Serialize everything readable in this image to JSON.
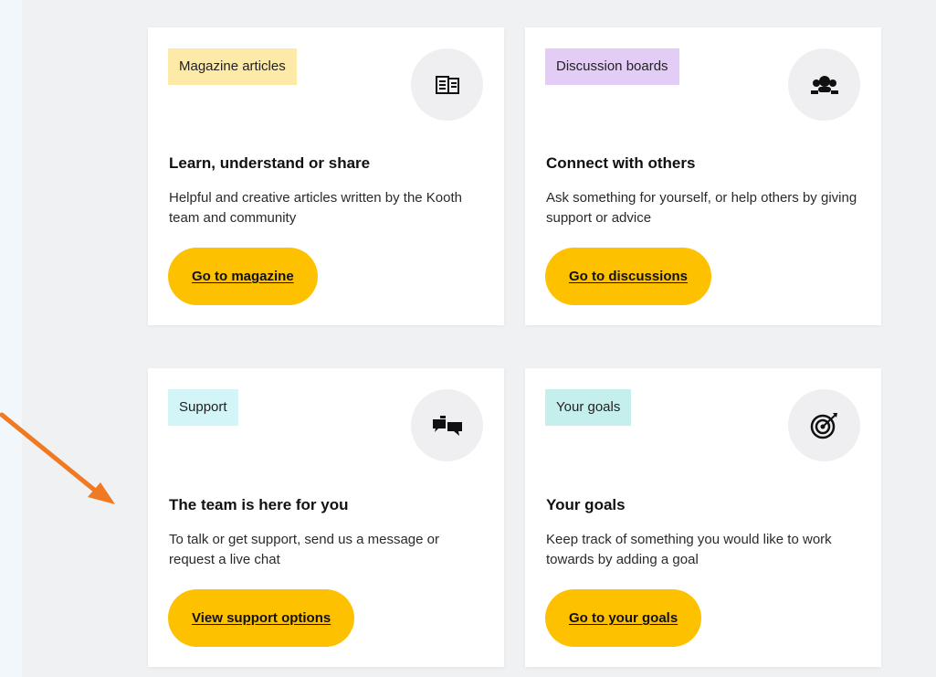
{
  "colors": {
    "background": "#f0f1f3",
    "card": "#ffffff",
    "button": "#fdc100",
    "arrow": "#f07a22"
  },
  "cards": [
    {
      "tag": "Magazine articles",
      "tag_color": "#fde9a8",
      "icon": "newspaper-icon",
      "title": "Learn, understand or share",
      "description": "Helpful and creative articles written by the Kooth team and community",
      "button": "Go to magazine"
    },
    {
      "tag": "Discussion boards",
      "tag_color": "#e3cdf7",
      "icon": "group-icon",
      "title": "Connect with others",
      "description": "Ask something for yourself, or help others by giving support or advice",
      "button": "Go to discussions"
    },
    {
      "tag": "Support",
      "tag_color": "#d3f5f8",
      "icon": "chat-bubbles-icon",
      "title": "The team is here for you",
      "description": "To talk or get support, send us a message or request a live chat",
      "button": "View support options"
    },
    {
      "tag": "Your goals",
      "tag_color": "#c5efec",
      "icon": "target-icon",
      "title": "Your goals",
      "description": "Keep track of something you would like to work towards by adding a goal",
      "button": "Go to your goals"
    }
  ]
}
